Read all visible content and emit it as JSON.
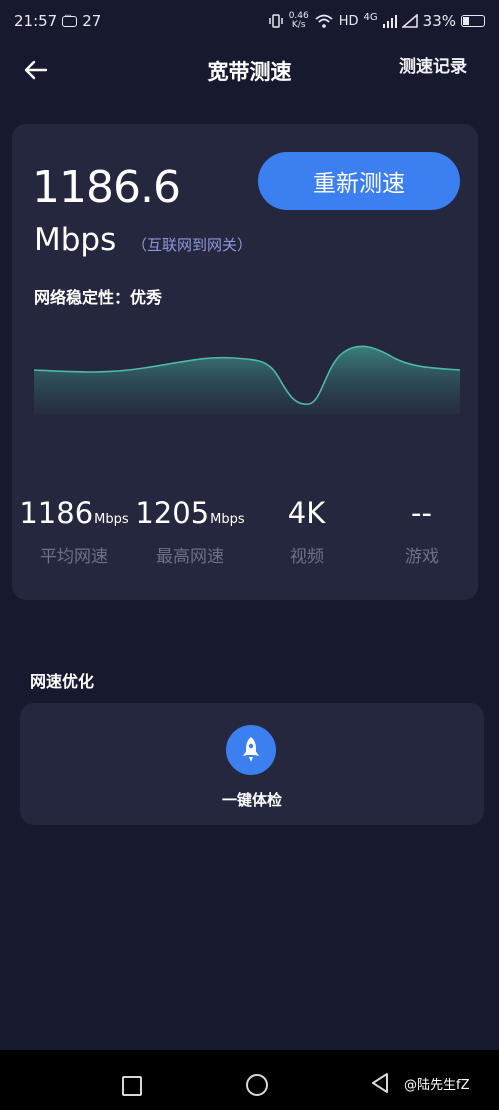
{
  "status_bar": {
    "time": "21:57",
    "notification_count": "27",
    "net_speed_value": "0.46",
    "net_speed_unit": "K/s",
    "signal_type": "HD",
    "network": "4G",
    "battery": "33%"
  },
  "nav": {
    "title": "宽带测速",
    "history": "测速记录"
  },
  "result": {
    "speed_value": "1186.6",
    "speed_unit": "Mbps",
    "speed_note": "（互联网到网关）",
    "retest_label": "重新测速",
    "stability_label": "网络稳定性：",
    "stability_value": "优秀",
    "metrics": [
      {
        "value": "1186",
        "unit": "Mbps",
        "label": "平均网速"
      },
      {
        "value": "1205",
        "unit": "Mbps",
        "label": "最高网速"
      },
      {
        "value": "4K",
        "unit": "",
        "label": "视频"
      },
      {
        "value": "--",
        "unit": "",
        "label": "游戏"
      }
    ]
  },
  "optimize": {
    "section_title": "网速优化",
    "one_click_label": "一键体检"
  },
  "watermark": "@陆先生fZ",
  "colors": {
    "background": "#171a2f",
    "card": "#24273e",
    "accent": "#3c7ff0",
    "chart_line": "#4fb8a8",
    "note": "#8f96d8",
    "muted_label": "#6c7088"
  },
  "icons": {
    "back": "arrow-left-icon",
    "rocket": "rocket-icon",
    "nav_back": "triangle-back-icon",
    "nav_home": "circle-home-icon",
    "nav_recent": "square-recent-icon"
  }
}
